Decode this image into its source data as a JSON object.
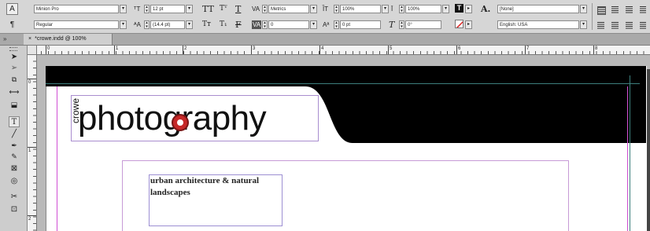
{
  "control_panel": {
    "char_mode": "A",
    "para_mode": "¶",
    "font_family": "Minion Pro",
    "font_style": "Regular",
    "font_size": "12 pt",
    "leading": "(14.4 pt)",
    "kerning": "Metrics",
    "tracking": "0",
    "vertical_scale": "100%",
    "horizontal_scale": "100%",
    "baseline_shift": "0 pt",
    "skew": "0°",
    "char_style": "[None]",
    "language": "English: USA"
  },
  "tab": {
    "title": "*crowe.indd @ 100%",
    "close": "×"
  },
  "ruler": {
    "labels": [
      "0",
      "1",
      "2",
      "3",
      "4",
      "5",
      "6",
      "7",
      "8"
    ]
  },
  "vruler": {
    "labels": [
      "0",
      "1",
      "2"
    ]
  },
  "document": {
    "logo_small": "crowe",
    "logo_main": "photography",
    "tagline": "urban architecture & natural landscapes"
  },
  "colors": {
    "logo_accent": "#c62828",
    "banner": "#000000",
    "margin_guide": "#d04fd4",
    "frame_edge": "#9d8fd3"
  }
}
